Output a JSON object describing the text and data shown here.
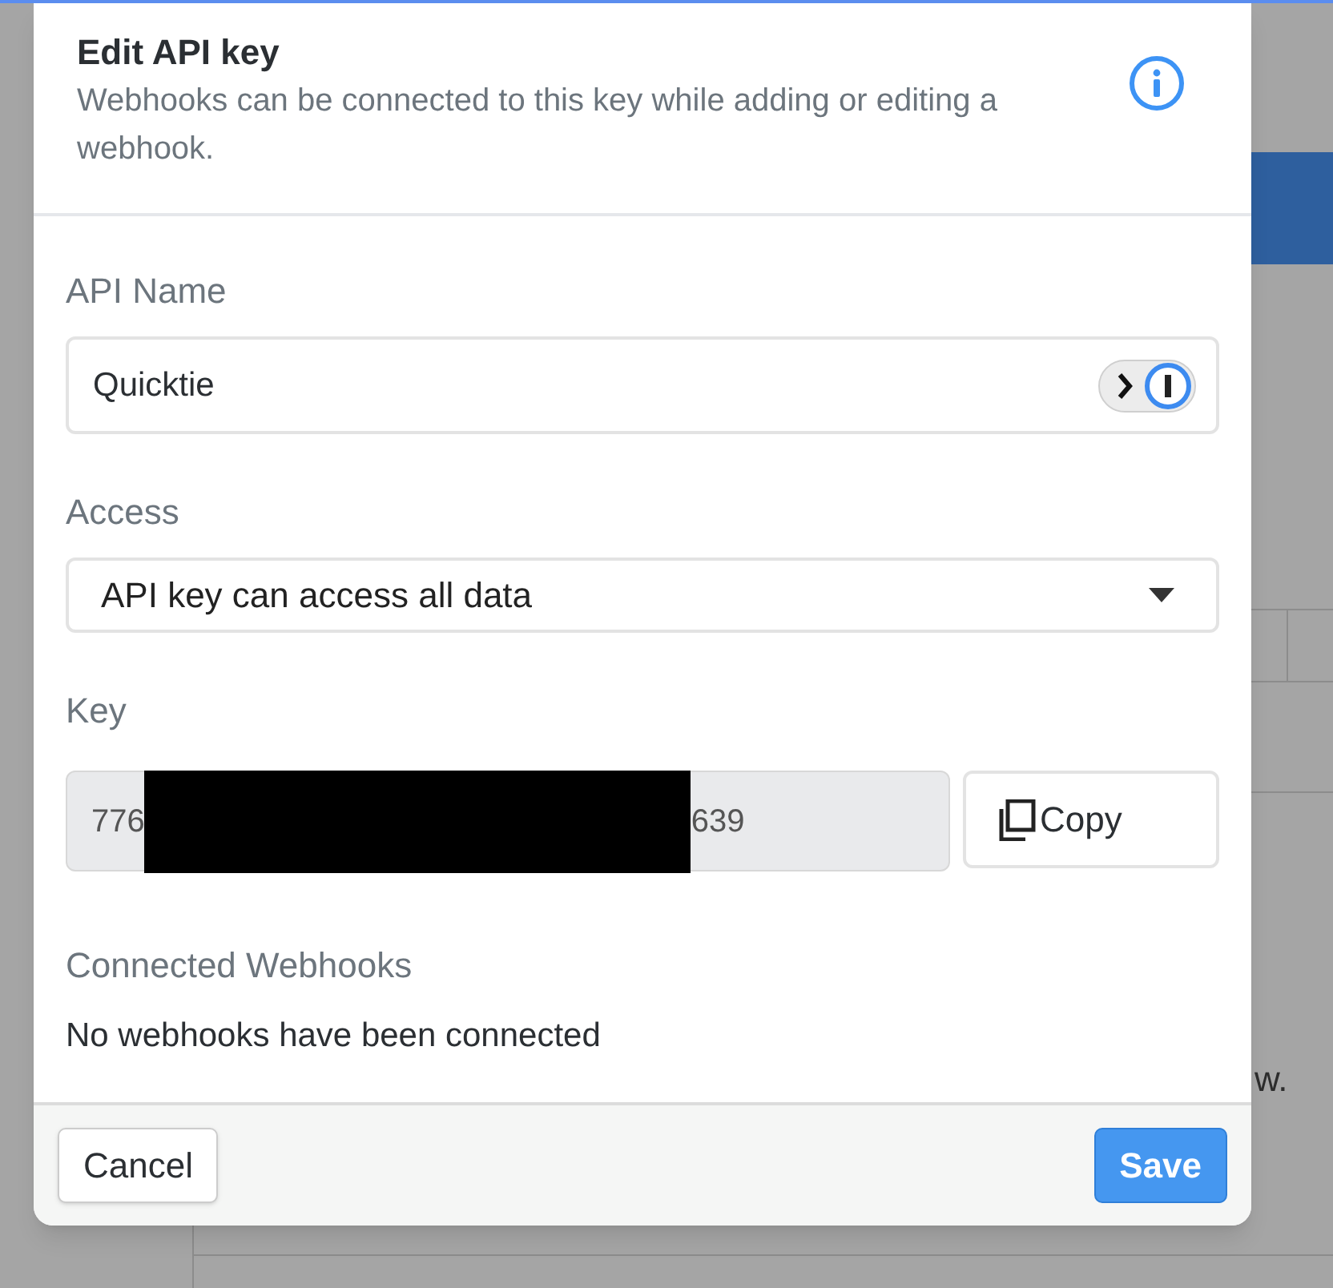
{
  "dialog": {
    "title": "Edit API key",
    "subtitle": "Webhooks can be connected to this key while adding or editing a webhook."
  },
  "fields": [
    {
      "kind": "text",
      "label": "API Name",
      "value": "Quicktie"
    },
    {
      "kind": "select",
      "label": "Access",
      "value": "API key can access all data"
    },
    {
      "kind": "key",
      "label": "Key",
      "prefix": "776",
      "suffix": "639",
      "redacted": true,
      "button": "Copy"
    }
  ],
  "webhooks": {
    "heading": "Connected Webhooks",
    "empty_text": "No webhooks have been connected"
  },
  "footer": {
    "cancel": "Cancel",
    "save": "Save"
  },
  "background": {
    "text_fragment": "w."
  }
}
